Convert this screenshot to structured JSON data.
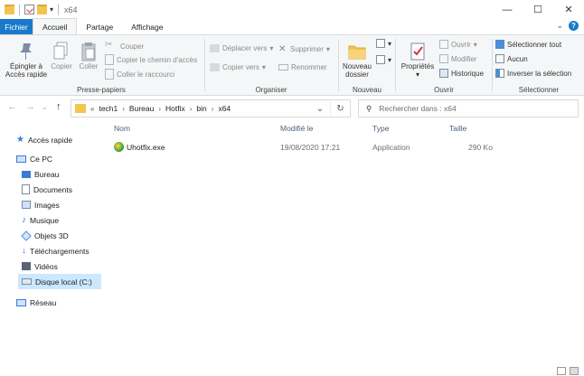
{
  "window": {
    "title": "x64",
    "quick_access": [
      "properties-icon",
      "new-folder-icon"
    ]
  },
  "tabs": [
    "Fichier",
    "Accueil",
    "Partage",
    "Affichage"
  ],
  "ribbon": {
    "presse_papiers": {
      "label": "Presse-papiers",
      "pin_label": "Épingler à Accès rapide",
      "copy_label": "Copier",
      "paste_label": "Coller",
      "cut_label": "Couper",
      "copy_path_label": "Copier le chemin d'accès",
      "paste_shortcut_label": "Coller le raccourci"
    },
    "organiser": {
      "label": "Organiser",
      "move_label": "Déplacer vers",
      "copy_to_label": "Copier vers",
      "delete_label": "Supprimer",
      "rename_label": "Renommer"
    },
    "nouveau": {
      "label": "Nouveau",
      "new_folder_label": "Nouveau dossier"
    },
    "ouvrir": {
      "label": "Ouvrir",
      "properties_label": "Propriétés",
      "open_label": "Ouvrir",
      "edit_label": "Modifier",
      "history_label": "Historique"
    },
    "selection": {
      "label": "Sélectionner",
      "select_all_label": "Sélectionner tout",
      "select_none_label": "Aucun",
      "invert_label": "Inverser la sélection"
    }
  },
  "address": {
    "overflow": "«",
    "crumbs": [
      "tech1",
      "Bureau",
      "Hotfix",
      "bin",
      "x64"
    ],
    "search_placeholder": "Rechercher dans : x64"
  },
  "nav": {
    "items": [
      {
        "label": "Accès rapide",
        "icon": "star-icon"
      },
      {
        "label": "Ce PC",
        "icon": "computer-icon"
      },
      {
        "label": "Bureau",
        "icon": "desktop-icon"
      },
      {
        "label": "Documents",
        "icon": "documents-icon"
      },
      {
        "label": "Images",
        "icon": "images-icon"
      },
      {
        "label": "Musique",
        "icon": "music-icon"
      },
      {
        "label": "Objets 3D",
        "icon": "objects3d-icon"
      },
      {
        "label": "Téléchargements",
        "icon": "downloads-icon"
      },
      {
        "label": "Vidéos",
        "icon": "videos-icon"
      },
      {
        "label": "Disque local (C:)",
        "icon": "drive-icon"
      },
      {
        "label": "Réseau",
        "icon": "network-icon"
      }
    ]
  },
  "columns": [
    "Nom",
    "Modifié le",
    "Type",
    "Taille"
  ],
  "files": [
    {
      "name": "Uhotfix.exe",
      "modified": "19/08/2020 17:21",
      "type": "Application",
      "size": "290 Ko",
      "icon": "exe-icon"
    }
  ],
  "colors": {
    "accent": "#1979ca",
    "selected": "#cce8ff",
    "ribbon_bg": "#f5f6f7"
  }
}
